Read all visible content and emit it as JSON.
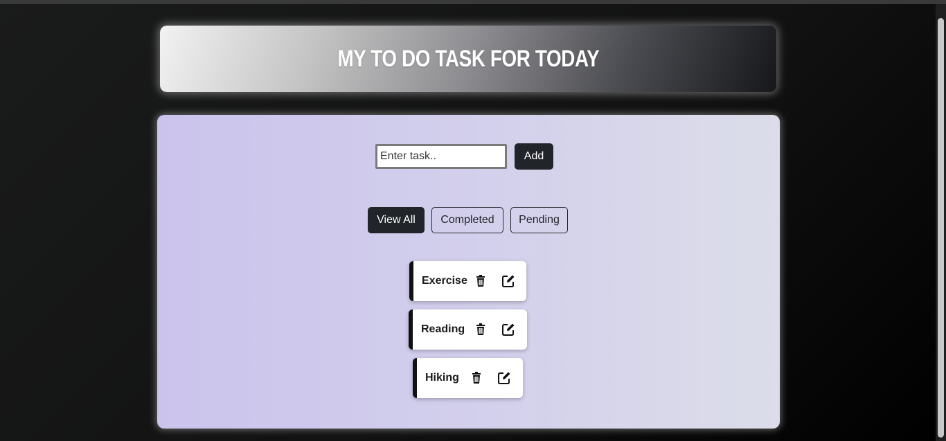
{
  "header": {
    "title": "My To Do Task for Today"
  },
  "form": {
    "placeholder": "Enter task..",
    "add_label": "Add"
  },
  "filters": [
    {
      "label": "View All",
      "active": true
    },
    {
      "label": "Completed",
      "active": false
    },
    {
      "label": "Pending",
      "active": false
    }
  ],
  "tasks": [
    {
      "name": "Exercise",
      "delete_icon": "trash-icon",
      "edit_icon": "edit-icon"
    },
    {
      "name": "Reading",
      "delete_icon": "trash-icon",
      "edit_icon": "edit-icon"
    },
    {
      "name": "Hiking",
      "delete_icon": "trash-icon",
      "edit_icon": "edit-icon"
    }
  ],
  "colors": {
    "dark_button": "#212529",
    "card_start": "#cbc3ec",
    "card_end": "#dcdde9"
  }
}
